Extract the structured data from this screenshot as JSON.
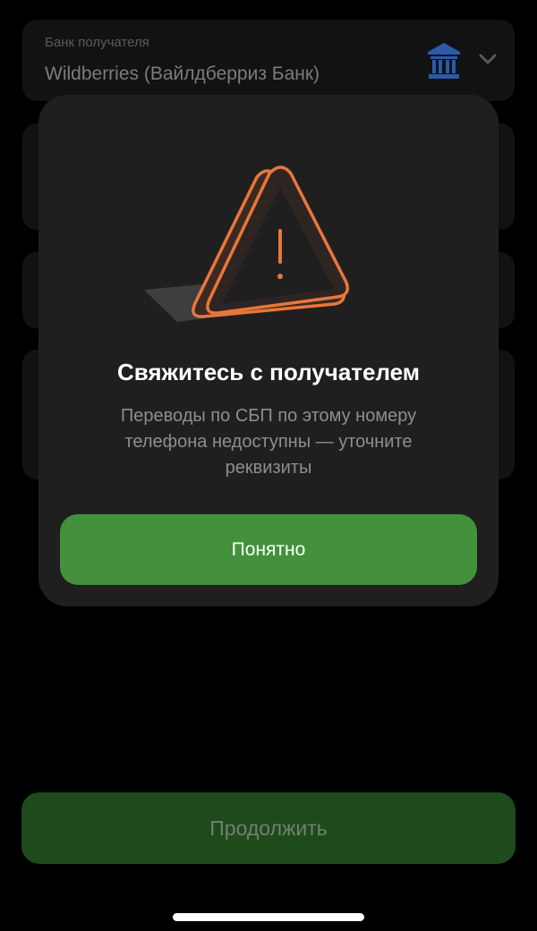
{
  "bank_field": {
    "label": "Банк получателя",
    "value": "Wildberries (Вайлдберриз Банк)",
    "icon": "bank-icon",
    "dropdown_icon": "chevron-down-icon"
  },
  "dialog": {
    "icon": "warning-triangle-icon",
    "title": "Свяжитесь с получателем",
    "message": "Переводы по СБП по этому номеру телефона недоступны — уточните реквизиты",
    "button_label": "Понятно"
  },
  "continue_button_label": "Продолжить",
  "colors": {
    "accent_green": "#43913d",
    "disabled_green": "#1e4a1c",
    "warning_orange": "#e8773a",
    "bank_blue": "#2a5aa8"
  }
}
